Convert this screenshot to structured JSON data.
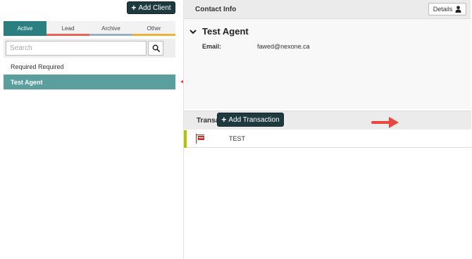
{
  "left": {
    "add_client_label": "Add Client",
    "tabs": [
      {
        "label": "Active",
        "color": "#2b7f80",
        "active": true
      },
      {
        "label": "Lead",
        "color": "#e8645a",
        "active": false
      },
      {
        "label": "Archive",
        "color": "#9ab0c2",
        "active": false
      },
      {
        "label": "Other",
        "color": "#f0b13a",
        "active": false
      }
    ],
    "search": {
      "placeholder": "Search",
      "value": ""
    },
    "clients": [
      {
        "name": "Required Required",
        "selected": false
      },
      {
        "name": "Test Agent",
        "selected": true
      }
    ]
  },
  "contact": {
    "header": "Contact Info",
    "details_label": "Details",
    "agent_name": "Test Agent",
    "email_label": "Email:",
    "email_value": "fawed@nexone.ca"
  },
  "transactions": {
    "header": "Transactions",
    "add_label": "Add Transaction",
    "items": [
      {
        "name": "TEST",
        "status_color": "#b5c400"
      }
    ]
  },
  "colors": {
    "accent": "#2b7f80",
    "selected_row": "#5a9e9e",
    "dark_button": "#1f3a3f",
    "annotation_arrow": "#e8463f"
  }
}
